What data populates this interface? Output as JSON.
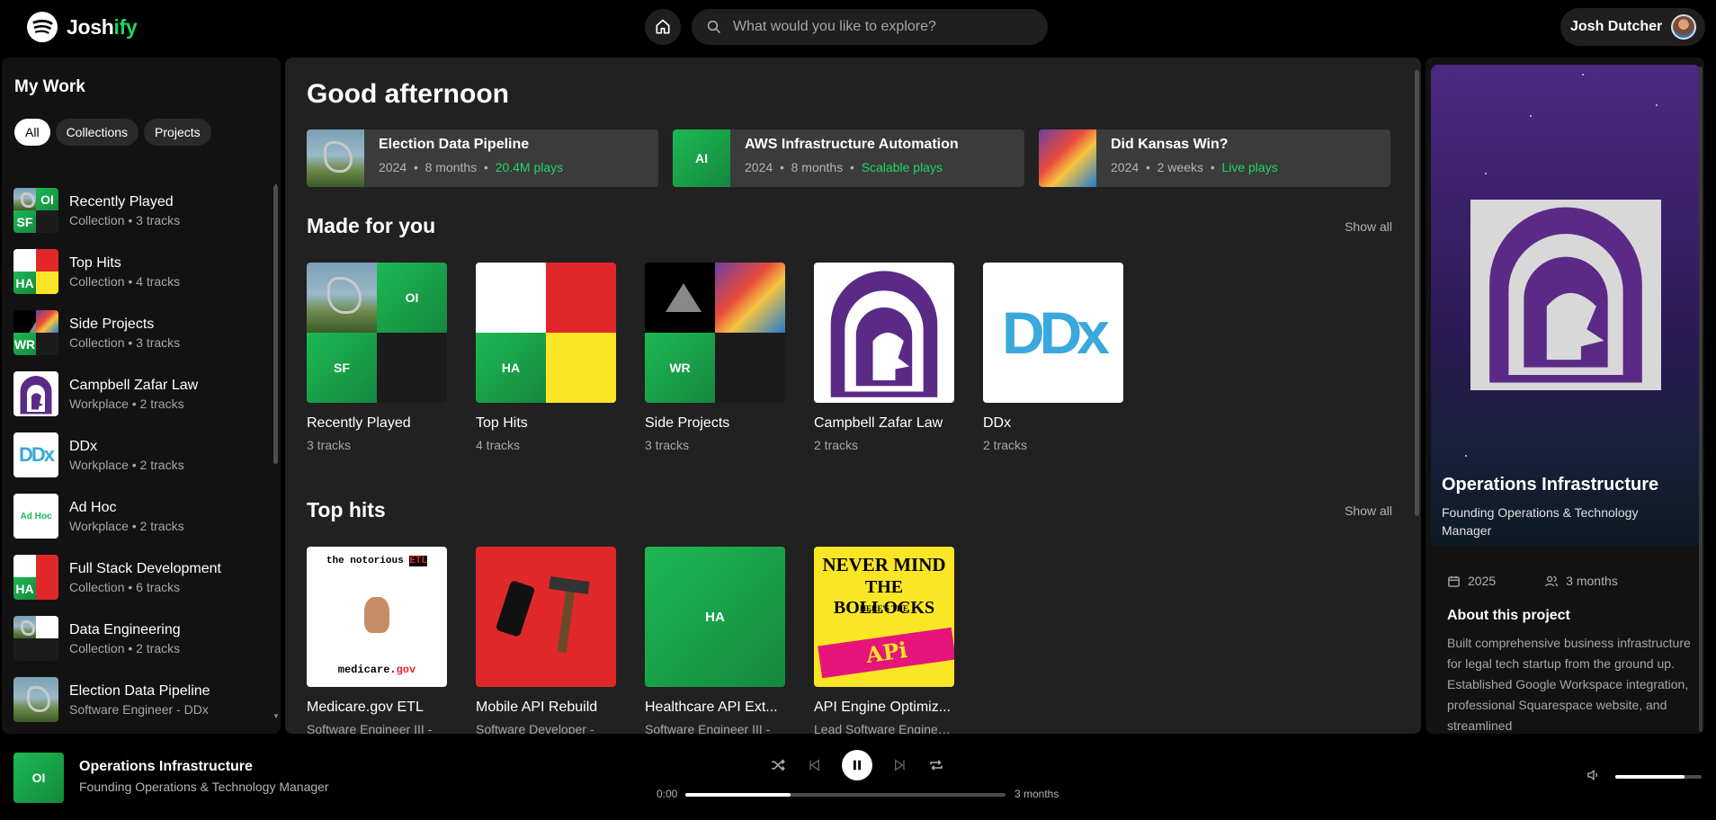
{
  "app": {
    "brand_main": "Josh",
    "brand_accent": "ify",
    "accent_color": "#1ed760"
  },
  "search": {
    "placeholder": "What would you like to explore?"
  },
  "user": {
    "name": "Josh Dutcher"
  },
  "sidebar": {
    "title": "My Work",
    "filters": [
      "All",
      "Collections",
      "Projects"
    ],
    "items": [
      {
        "name": "Recently Played",
        "sub": "Collection • 3 tracks"
      },
      {
        "name": "Top Hits",
        "sub": "Collection • 4 tracks"
      },
      {
        "name": "Side Projects",
        "sub": "Collection • 3 tracks"
      },
      {
        "name": "Campbell Zafar Law",
        "sub": "Workplace • 2 tracks"
      },
      {
        "name": "DDx",
        "sub": "Workplace • 2 tracks"
      },
      {
        "name": "Ad Hoc",
        "sub": "Workplace • 2 tracks"
      },
      {
        "name": "Full Stack Development",
        "sub": "Collection • 6 tracks"
      },
      {
        "name": "Data Engineering",
        "sub": "Collection • 2 tracks"
      },
      {
        "name": "Election Data Pipeline",
        "sub": "Software Engineer - DDx"
      }
    ],
    "thumb_labels": {
      "oi": "OI",
      "sf": "SF",
      "ha": "HA",
      "wr": "WR",
      "adhoc": "Ad Hoc"
    }
  },
  "main": {
    "greeting": "Good afternoon",
    "quick": [
      {
        "title": "Election Data Pipeline",
        "year": "2024",
        "duration": "8 months",
        "plays": "20.4M plays"
      },
      {
        "title": "AWS Infrastructure Automation",
        "year": "2024",
        "duration": "8 months",
        "plays": "Scalable plays",
        "thumb": "AI"
      },
      {
        "title": "Did Kansas Win?",
        "year": "2024",
        "duration": "2 weeks",
        "plays": "Live plays"
      }
    ],
    "sep": "•",
    "made_for_you": {
      "title": "Made for you",
      "show_all": "Show all",
      "cards": [
        {
          "title": "Recently Played",
          "sub": "3 tracks"
        },
        {
          "title": "Top Hits",
          "sub": "4 tracks"
        },
        {
          "title": "Side Projects",
          "sub": "3 tracks"
        },
        {
          "title": "Campbell Zafar Law",
          "sub": "2 tracks"
        },
        {
          "title": "DDx",
          "sub": "2 tracks"
        }
      ]
    },
    "top_hits": {
      "title": "Top hits",
      "show_all": "Show all",
      "cards": [
        {
          "title": "Medicare.gov ETL",
          "sub": "Software Engineer III - "
        },
        {
          "title": "Mobile API Rebuild",
          "sub": "Software Developer - "
        },
        {
          "title": "Healthcare API Ext...",
          "sub": "Software Engineer III - "
        },
        {
          "title": "API Engine Optimiz...",
          "sub": "Lead Software Enginee..."
        }
      ]
    },
    "cover_text": {
      "notorious": "the notorious",
      "etl": "ETL",
      "medicare": "medicare.",
      "gov": "gov",
      "never": "NEVER MIND",
      "bollocks": "THE BOLLOCKS",
      "heres": "HERE'S THE",
      "api": "APi ENgiNe",
      "ddx": "DDx"
    }
  },
  "panel": {
    "title": "Operations Infrastructure",
    "subtitle": "Founding Operations & Technology Manager",
    "year": "2025",
    "duration": "3 months",
    "about_heading": "About this project",
    "about_text": "Built comprehensive business infrastructure for legal tech startup from the ground up. Established Google Workspace integration, professional Squarespace website, and streamlined"
  },
  "player": {
    "thumb": "OI",
    "title": "Operations Infrastructure",
    "subtitle": "Founding Operations & Technology Manager",
    "time_current": "0:00",
    "time_total": "3 months",
    "progress": 0.33,
    "volume": 0.8
  }
}
